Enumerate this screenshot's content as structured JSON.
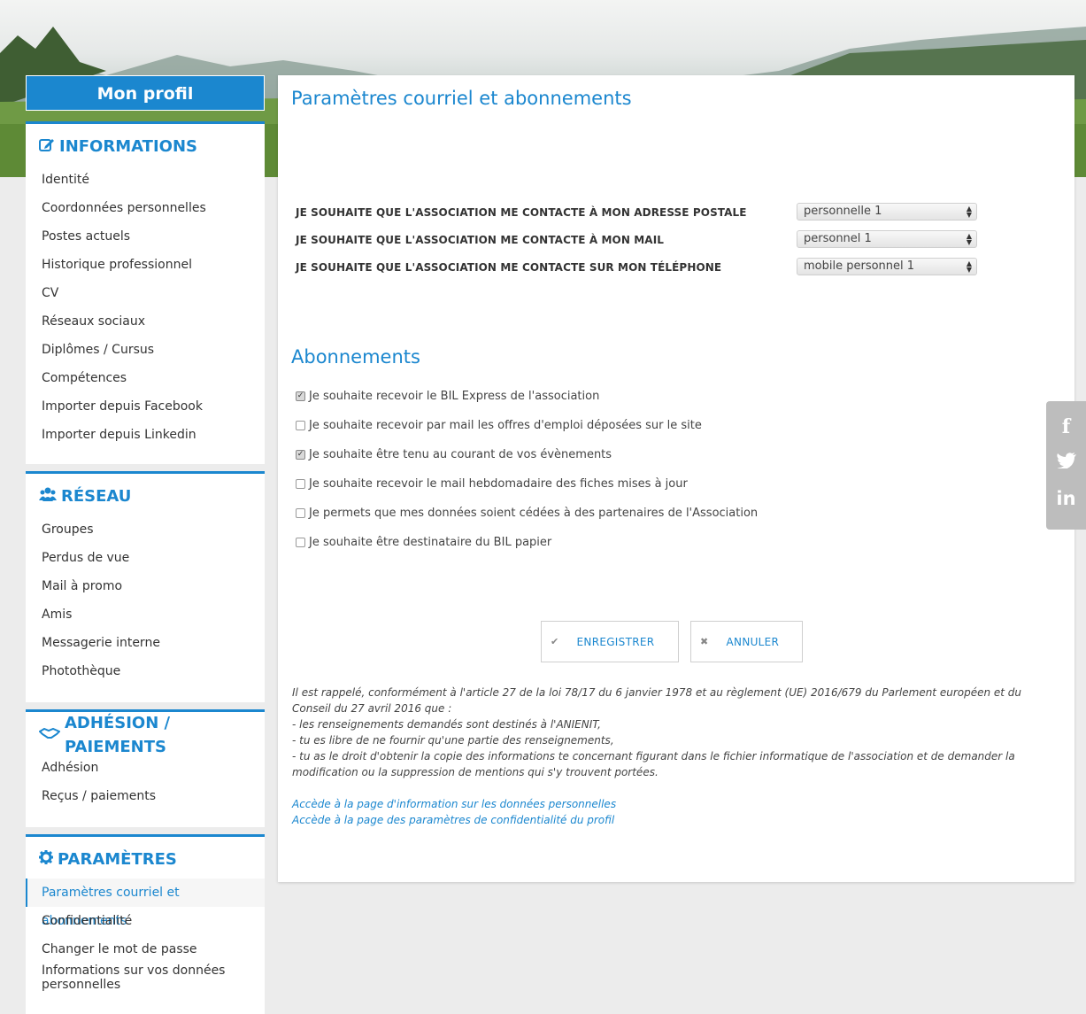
{
  "sidebar": {
    "profile_title": "Mon profil",
    "sections": [
      {
        "title": "INFORMATIONS",
        "icon": "edit-icon",
        "items": [
          "Identité",
          "Coordonnées personnelles",
          "Postes actuels",
          "Historique professionnel",
          "CV",
          "Réseaux sociaux",
          "Diplômes / Cursus",
          "Compétences",
          "Importer depuis Facebook",
          "Importer depuis Linkedin"
        ]
      },
      {
        "title": "RÉSEAU",
        "icon": "users-icon",
        "items": [
          "Groupes",
          "Perdus de vue",
          "Mail à promo",
          "Amis",
          "Messagerie interne",
          "Photothèque"
        ]
      },
      {
        "title": "ADHÉSION / PAIEMENTS",
        "icon": "handshake-icon",
        "items": [
          "Adhésion",
          "Reçus / paiements"
        ]
      },
      {
        "title": "PARAMÈTRES",
        "icon": "gear-icon",
        "items": [
          "Paramètres courriel et abonnements",
          "Confidentialité",
          "Changer le mot de passe",
          "Informations sur vos données personnelles"
        ],
        "active_index": 0
      }
    ]
  },
  "main": {
    "title": "Paramètres courriel et abonnements",
    "prefs": [
      {
        "label": "JE SOUHAITE QUE L'ASSOCIATION ME CONTACTE À MON ADRESSE POSTALE",
        "value": "personnelle 1"
      },
      {
        "label": "JE SOUHAITE QUE L'ASSOCIATION ME CONTACTE À MON MAIL",
        "value": "personnel 1"
      },
      {
        "label": "JE SOUHAITE QUE L'ASSOCIATION ME CONTACTE SUR MON TÉLÉPHONE",
        "value": "mobile personnel 1"
      }
    ],
    "subscriptions_title": "Abonnements",
    "subscriptions": [
      {
        "label": "Je souhaite recevoir le BIL Express de l'association",
        "checked": true
      },
      {
        "label": "Je souhaite recevoir par mail les offres d'emploi déposées sur le site",
        "checked": false
      },
      {
        "label": "Je souhaite être tenu au courant de vos évènements",
        "checked": true
      },
      {
        "label": "Je souhaite recevoir le mail hebdomadaire des fiches mises à jour",
        "checked": false
      },
      {
        "label": "Je permets que mes données soient cédées à des partenaires de l'Association",
        "checked": false
      },
      {
        "label": "Je souhaite être destinataire du BIL papier",
        "checked": false
      }
    ],
    "save_label": "ENREGISTRER",
    "cancel_label": "ANNULER",
    "legal": {
      "intro": "Il est rappelé, conformément à l'article 27 de la loi 78/17 du 6 janvier 1978 et au règlement (UE) 2016/679 du Parlement européen et du Conseil du 27 avril 2016 que :",
      "line1": "- les renseignements demandés sont destinés à l'ANIENIT,",
      "line2": "- tu es libre de ne fournir qu'une partie des renseignements,",
      "line3": "- tu as le droit d'obtenir la copie des informations te concernant figurant dans le fichier informatique de l'association et de demander la modification ou la suppression de mentions qui s'y trouvent portées."
    },
    "links": {
      "personal_data": "Accède à la page d'information sur les données personnelles",
      "privacy": "Accède à la page des paramètres de confidentialité du profil"
    }
  },
  "social": [
    "facebook-icon",
    "twitter-icon",
    "linkedin-icon"
  ],
  "colors": {
    "accent": "#1b87cf",
    "social_bg": "#bdbdbd"
  }
}
